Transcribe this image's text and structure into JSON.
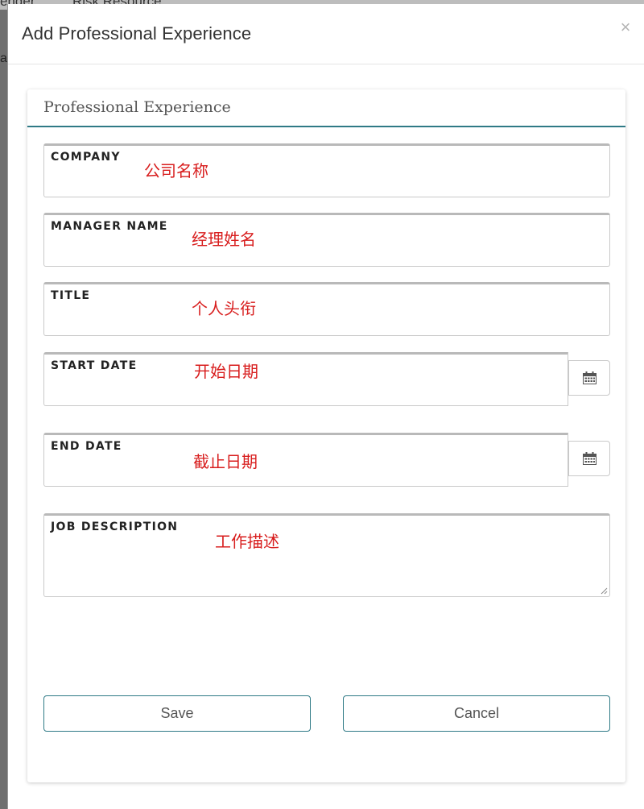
{
  "background": {
    "tab_partial_1": "ender",
    "tab_partial_2": "Risk Resource",
    "edge_char": "a"
  },
  "modal": {
    "title": "Add Professional Experience",
    "close_glyph": "×"
  },
  "panel": {
    "title": "Professional Experience"
  },
  "fields": {
    "company": {
      "label": "COMPANY",
      "value": "公司名称"
    },
    "manager_name": {
      "label": "MANAGER NAME",
      "value": "经理姓名"
    },
    "title": {
      "label": "TITLE",
      "value": "个人头衔"
    },
    "start_date": {
      "label": "START DATE",
      "value": "开始日期"
    },
    "end_date": {
      "label": "END DATE",
      "value": "截止日期"
    },
    "job_description": {
      "label": "JOB DESCRIPTION",
      "value": "工作描述"
    }
  },
  "buttons": {
    "save": "Save",
    "cancel": "Cancel"
  },
  "icons": {
    "calendar": "calendar-icon",
    "close": "close-icon"
  },
  "colors": {
    "accent": "#2f7a86",
    "annotation": "#d81e1e"
  }
}
